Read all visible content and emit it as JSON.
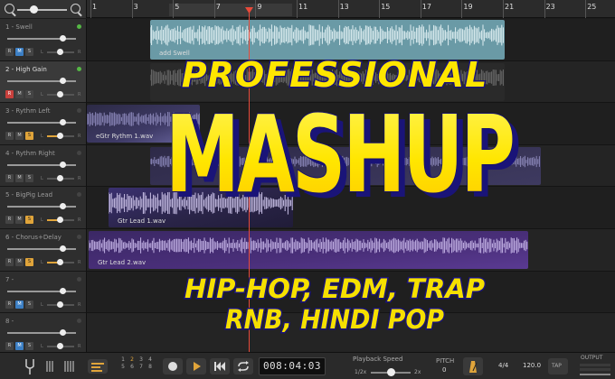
{
  "ruler": {
    "bars": [
      "1",
      "3",
      "5",
      "7",
      "9",
      "11",
      "13",
      "15",
      "17",
      "19",
      "21",
      "23",
      "25"
    ]
  },
  "tracks": [
    {
      "name": "1 - Swell",
      "rec": false,
      "mute": true,
      "solo": false,
      "led": true,
      "selected": false
    },
    {
      "name": "2 - High Gain",
      "rec": true,
      "mute": false,
      "solo": false,
      "led": true,
      "selected": true
    },
    {
      "name": "3 - Rythm Left",
      "rec": false,
      "mute": false,
      "solo": true,
      "led": false,
      "selected": false
    },
    {
      "name": "4 - Rythm Right",
      "rec": false,
      "mute": false,
      "solo": false,
      "led": false,
      "selected": false
    },
    {
      "name": "5 - BigPig Lead",
      "rec": false,
      "mute": false,
      "solo": true,
      "led": false,
      "selected": false
    },
    {
      "name": "6 - Chorus+Delay",
      "rec": false,
      "mute": false,
      "solo": true,
      "led": false,
      "selected": false
    },
    {
      "name": "7 - ",
      "rec": false,
      "mute": true,
      "solo": false,
      "led": false,
      "selected": false
    },
    {
      "name": "8 - ",
      "rec": false,
      "mute": true,
      "solo": false,
      "led": false,
      "selected": false
    }
  ],
  "button_labels": {
    "rec": "R",
    "mute": "M",
    "solo": "S",
    "left": "L",
    "right": "R"
  },
  "clips": {
    "swell": "add Swell",
    "rythm": "eGtr Rythm 1.wav",
    "lead": "Gtr Lead 1.wav",
    "lead2": "Gtr Lead 2.wav"
  },
  "overlay": {
    "line1": "PROFESSIONAL",
    "line2": "MASHUP",
    "line3": "HIP-HOP, EDM, TRAP",
    "line4": "RNB, HINDI POP"
  },
  "transport": {
    "track_numbers": [
      "1",
      "2",
      "3",
      "4",
      "5",
      "6",
      "7",
      "8"
    ],
    "time": "008:04:03",
    "playback_label": "Playback Speed",
    "speed_min": "1/2x",
    "speed_max": "2x",
    "pitch_label": "PITCH",
    "pitch_value": "0",
    "time_sig": "4/4",
    "tempo": "120.0",
    "tap": "TAP",
    "output": "OUTPUT"
  },
  "colors": {
    "teal_clip": "#6a9aa6",
    "purple_clip": "#4a2f7a",
    "playhead": "#e84a3a",
    "title_yellow": "#ffe600",
    "subtitle_yellow": "#f6e000",
    "accent_orange": "#e0a43a"
  }
}
